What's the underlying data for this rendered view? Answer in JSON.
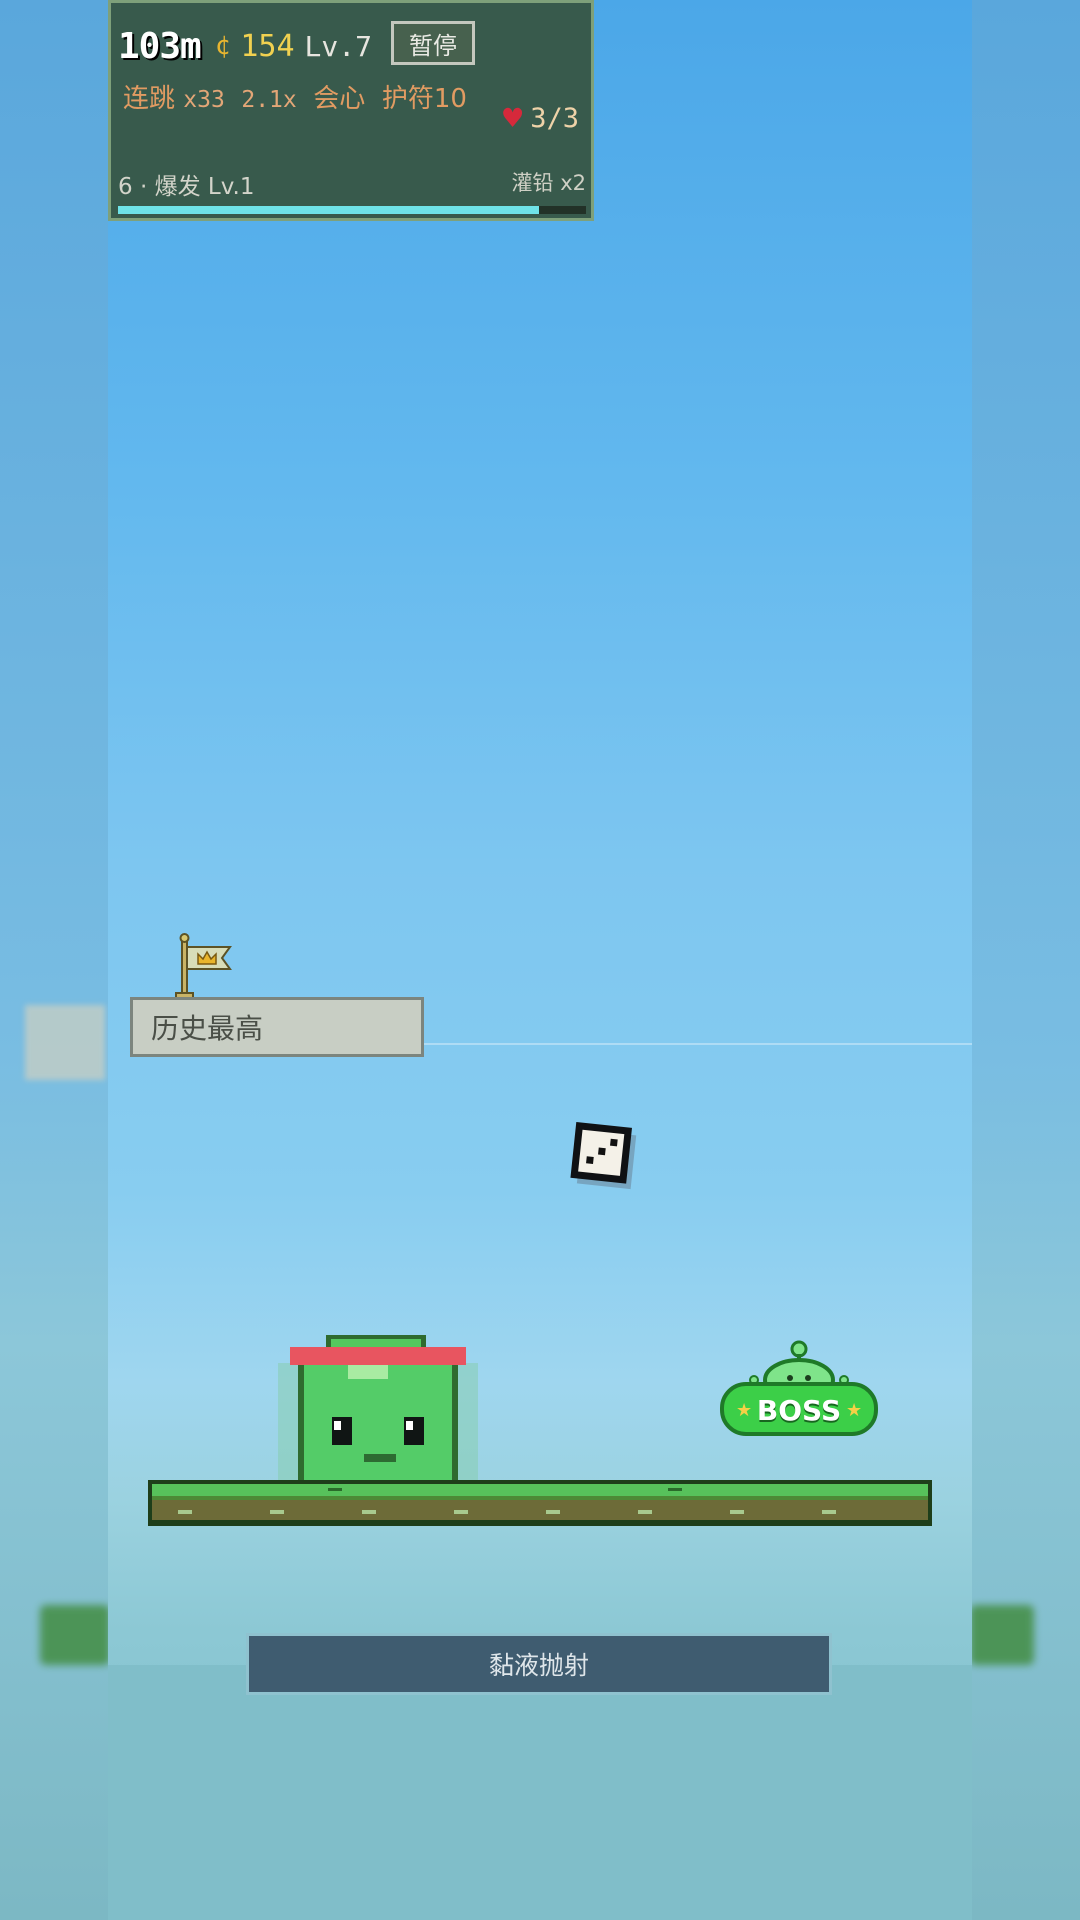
{
  "hud": {
    "distance": "103m",
    "coin_icon": "coin-icon",
    "coins": "154",
    "level": "Lv.7",
    "pause_label": "暂停",
    "combo_label": "连跳",
    "combo_value": "x33",
    "multiplier": "2.1x",
    "crit_label": "会心",
    "charm_label": "护符10",
    "lives": "3/3",
    "skill_text": "6 · 爆发 Lv.1",
    "buff_text": "灌铅 x2",
    "progress_fraction": 0.9,
    "colors": {
      "hud_bg": "#385a4c",
      "coin": "#f1d150",
      "combo": "#e19b62",
      "heart": "#d6293b",
      "progress": "#6fe3e8"
    }
  },
  "marker": {
    "best_label": "历史最高",
    "flag_icon": "flag-crown-icon"
  },
  "entities": {
    "dice_icon": "dice-icon",
    "slime_icon": "slime-player",
    "boss_label": "BOSS"
  },
  "action": {
    "label": "黏液抛射"
  }
}
